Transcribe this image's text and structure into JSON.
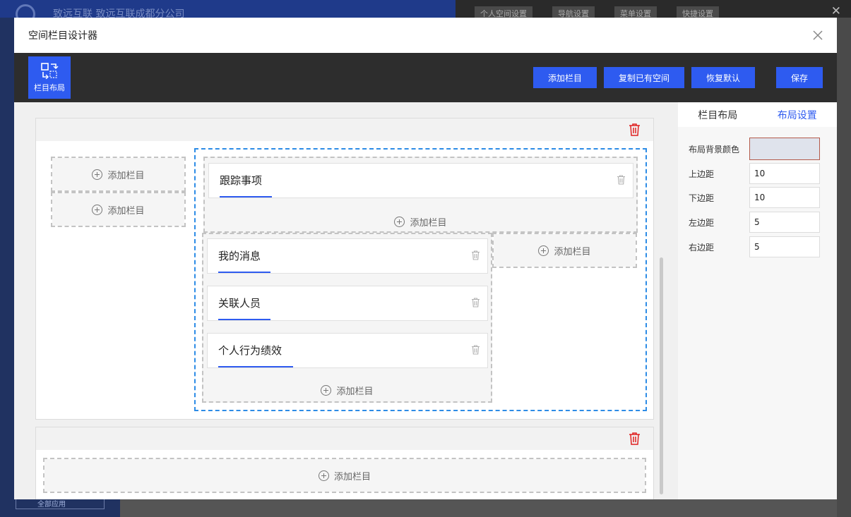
{
  "background": {
    "brand": "致远互联   致远互联成都分公司",
    "nav": [
      "个人空间设置",
      "导航设置",
      "菜单设置",
      "快捷设置"
    ],
    "bottom_search": "全部应用"
  },
  "dialog": {
    "title": "空间栏目设计器",
    "close_icon": "close-icon"
  },
  "toolbar": {
    "layout_tool_label": "栏目布局",
    "add_column": "添加栏目",
    "copy_space": "复制已有空间",
    "restore_default": "恢复默认",
    "save": "保存"
  },
  "canvas": {
    "add_column_label": "添加栏目",
    "cards": [
      {
        "title": "跟踪事项"
      },
      {
        "title": "我的消息"
      },
      {
        "title": "关联人员"
      },
      {
        "title": "个人行为绩效"
      }
    ]
  },
  "panel": {
    "tabs": [
      "栏目布局",
      "布局设置"
    ],
    "active_tab": "布局设置",
    "fields": [
      {
        "label": "布局背景颜色",
        "value": ""
      },
      {
        "label": "上边距",
        "value": "10"
      },
      {
        "label": "下边距",
        "value": "10"
      },
      {
        "label": "左边距",
        "value": "5"
      },
      {
        "label": "右边距",
        "value": "5"
      }
    ],
    "background_color": "#dfe3ec"
  },
  "colors": {
    "accent": "#2e5bf0",
    "delete": "#e02020",
    "selection": "#2d8ce6",
    "toolbar": "#2d2d2d"
  }
}
